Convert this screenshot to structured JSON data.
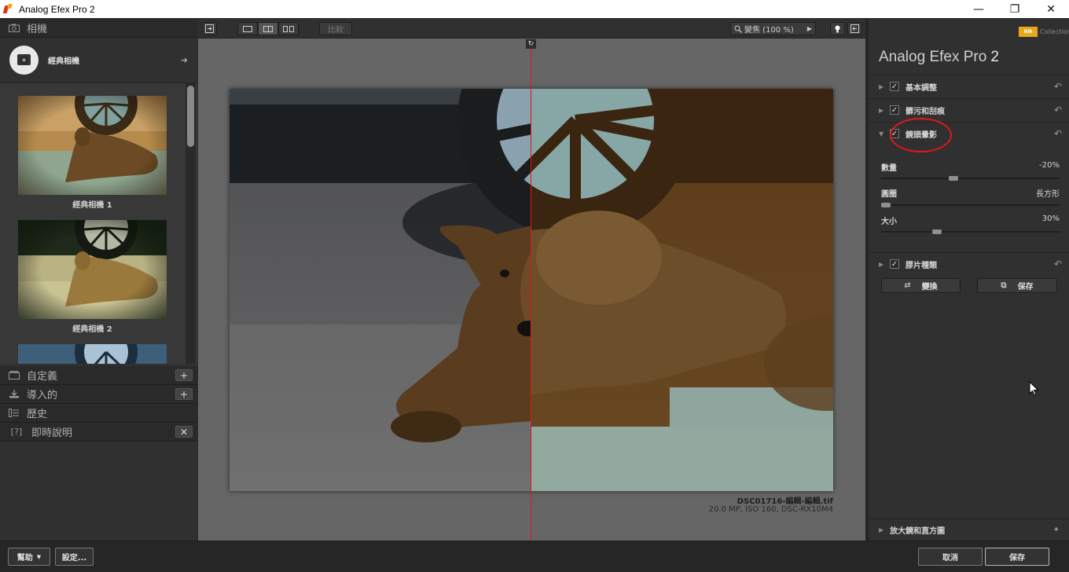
{
  "window": {
    "title": "Analog Efex Pro 2",
    "controls": [
      "minimize",
      "maximize",
      "close"
    ]
  },
  "left_panel": {
    "camera_section": {
      "label": "相機",
      "icon": "camera-icon"
    },
    "current_camera": {
      "name": "經典相機"
    },
    "presets": [
      {
        "label": "經典相機 1"
      },
      {
        "label": "經典相機 2"
      },
      {
        "label": ""
      }
    ],
    "sections": [
      {
        "label": "自定義",
        "icon": "folder-icon",
        "action": "+"
      },
      {
        "label": "導入的",
        "icon": "import-icon",
        "action": "+"
      },
      {
        "label": "歷史",
        "icon": "history-icon",
        "action": ""
      },
      {
        "label": "即時說明",
        "icon": "help-icon",
        "prefix": "[?]",
        "action": "✕"
      }
    ]
  },
  "toolbar": {
    "compare_label": "比較",
    "zoom_label": "變焦 (100 %)"
  },
  "image": {
    "file_name": "DSC01716-編輯-編輯.tif",
    "meta": "20.0 MP, ISO 160, DSC-RX10M4"
  },
  "right_panel": {
    "brand": {
      "badge": "Nik",
      "text": "Collection"
    },
    "product": {
      "name": "Analog Efex Pro",
      "version": "2"
    },
    "controls": [
      {
        "label": "基本調整",
        "checked": true,
        "expanded": false
      },
      {
        "label": "髒污和刮痕",
        "checked": true,
        "expanded": false
      },
      {
        "label": "鏡頭暈影",
        "checked": true,
        "expanded": true
      }
    ],
    "vignette": {
      "amount": {
        "label": "數量",
        "value": "-20%",
        "level": 0.4
      },
      "shape": {
        "label": "圓圈",
        "value": "長方形",
        "level": 0.0
      },
      "size": {
        "label": "大小",
        "value": "30%",
        "level": 0.3
      }
    },
    "film_type": {
      "label": "膠片種類",
      "checked": true
    },
    "buttons": {
      "shuffle": "變換",
      "save": "保存"
    },
    "loupe": {
      "label": "放大鏡和直方圖"
    }
  },
  "bottom_bar": {
    "help": "幫助",
    "settings": "設定...",
    "cancel": "取消",
    "save": "保存"
  },
  "colors": {
    "accent_red": "#e01818",
    "nik_orange": "#e9a61a",
    "panel_bg": "#303030",
    "canvas_bg": "#666666"
  }
}
